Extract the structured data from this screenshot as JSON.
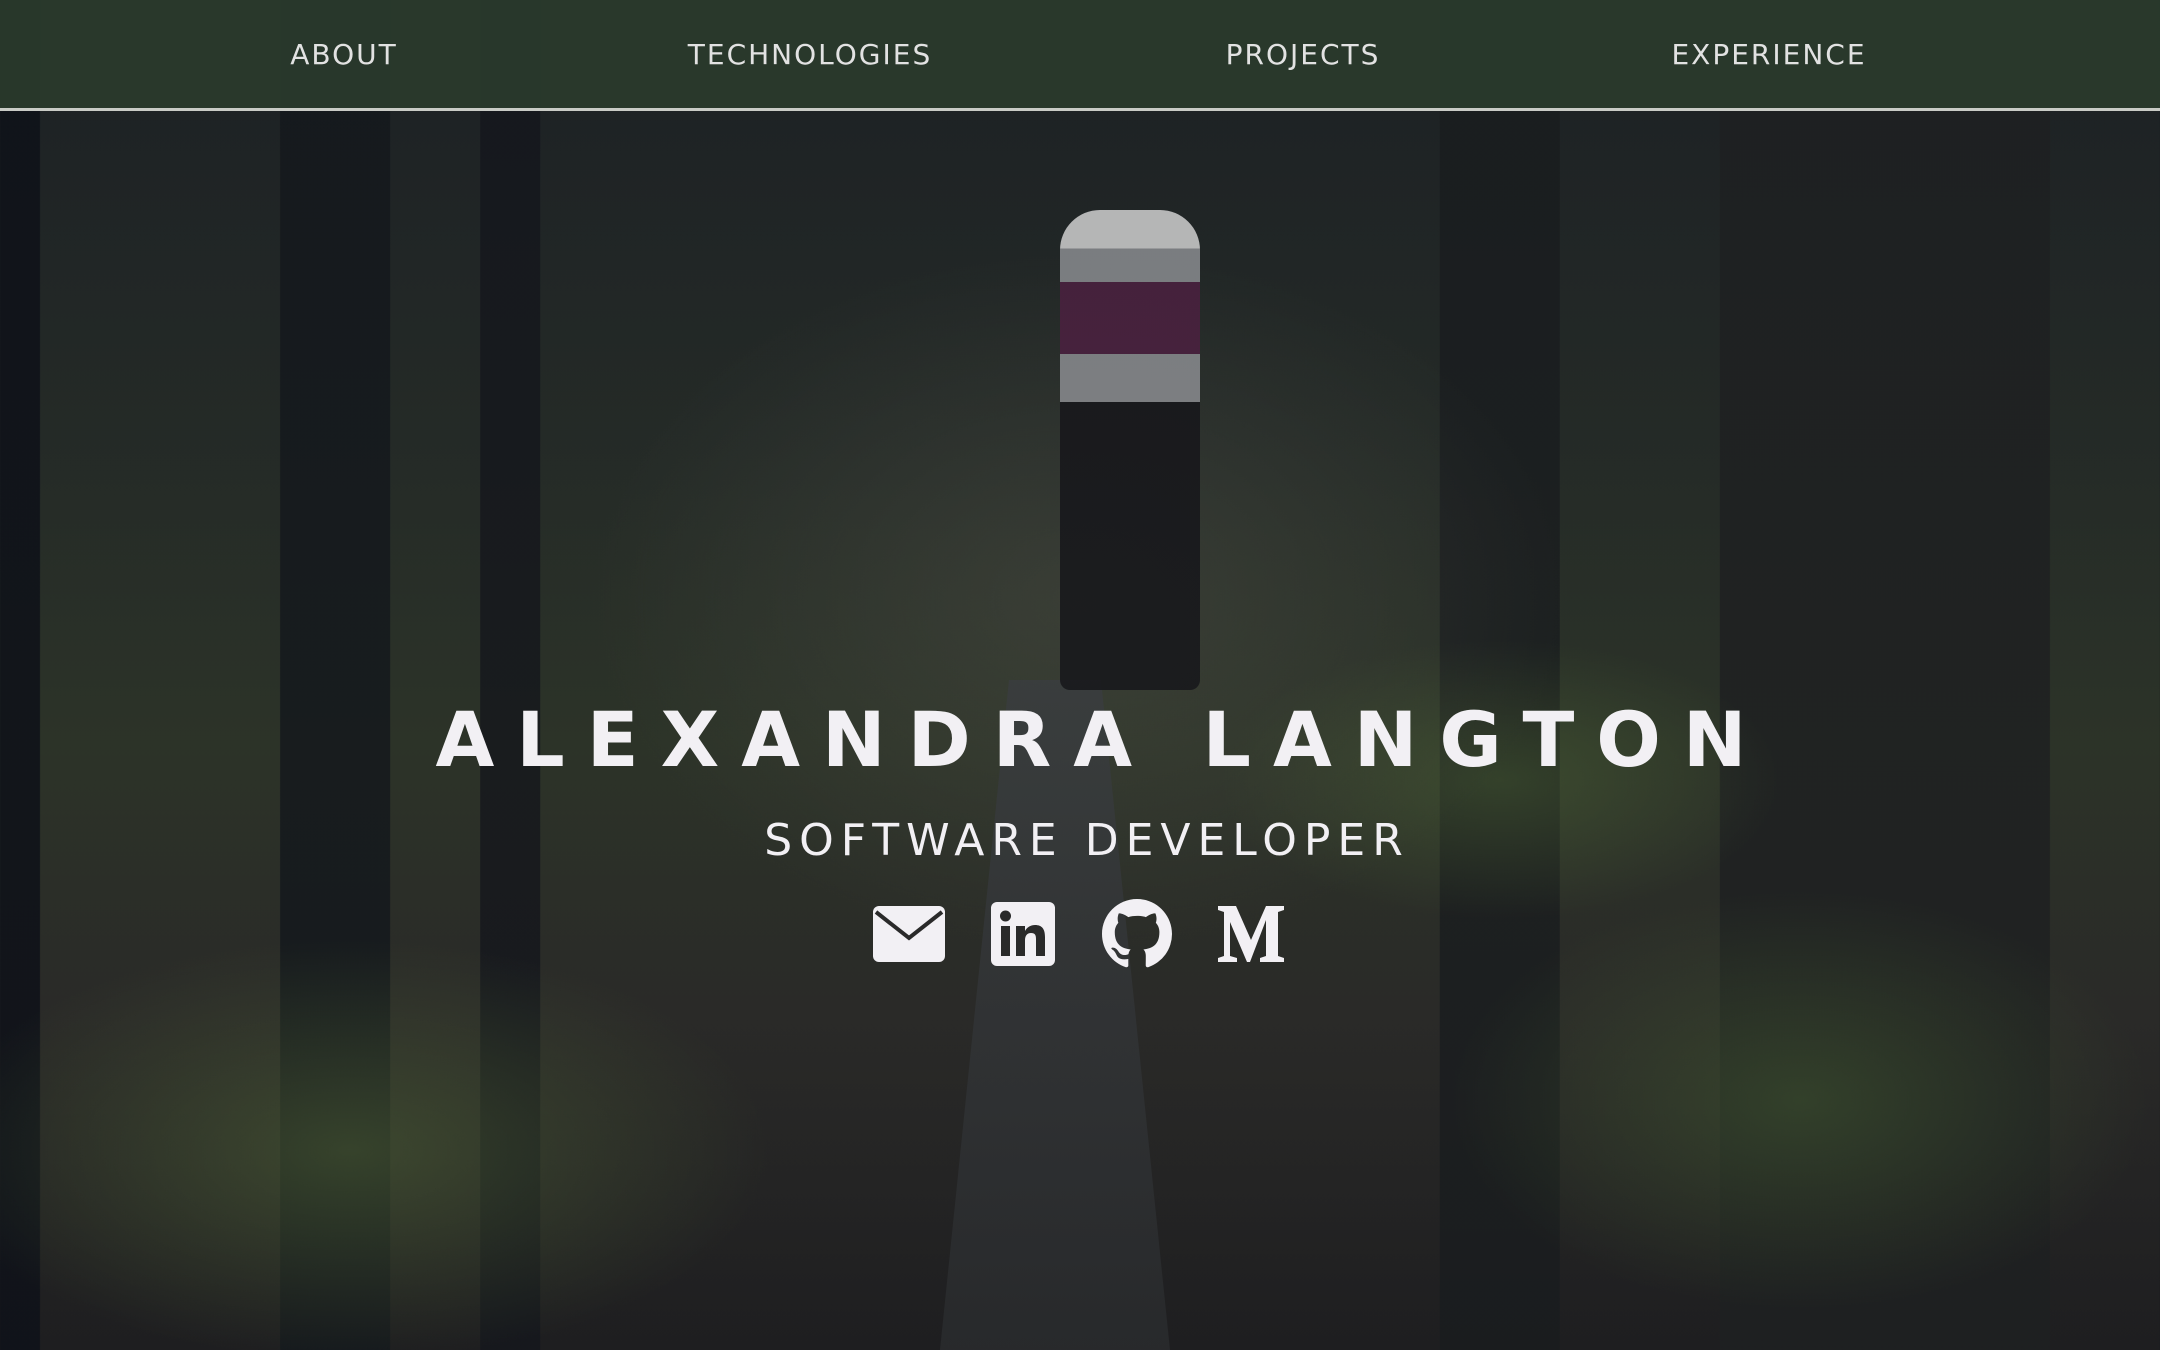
{
  "nav": {
    "items": [
      {
        "label": "ABOUT"
      },
      {
        "label": "TECHNOLOGIES"
      },
      {
        "label": "PROJECTS"
      },
      {
        "label": "EXPERIENCE"
      }
    ]
  },
  "hero": {
    "name": "ALEXANDRA LANGTON",
    "title": "SOFTWARE DEVELOPER"
  },
  "social": [
    "envelope-icon",
    "linkedin-icon",
    "github-icon",
    "medium-icon"
  ],
  "colors": {
    "nav_bg": "#2a3a2c",
    "text": "#f2f0f4"
  }
}
